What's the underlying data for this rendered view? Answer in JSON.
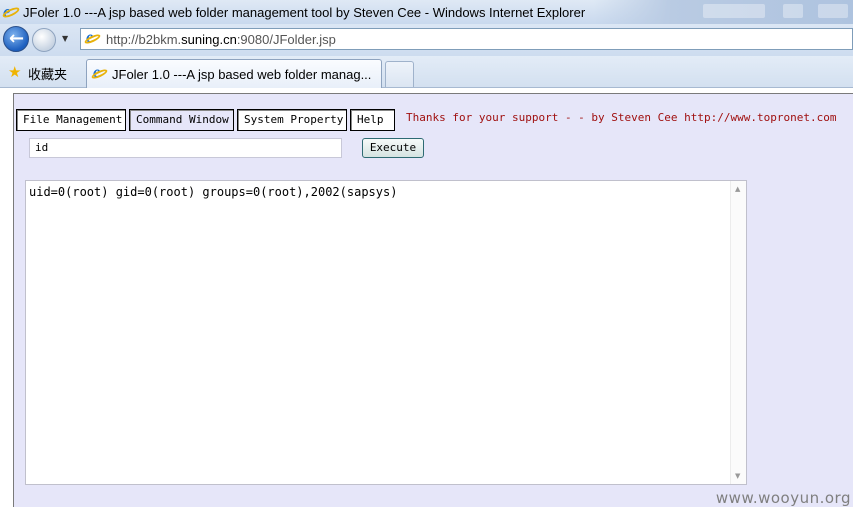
{
  "window": {
    "title": "JFoler 1.0 ---A jsp based web folder management tool by Steven Cee - Windows Internet Explorer"
  },
  "addressbar": {
    "url_prefix": "http://b2bkm.",
    "url_domain": "suning.cn",
    "url_suffix": ":9080/JFolder.jsp"
  },
  "favorites": {
    "label": "收藏夹"
  },
  "tab": {
    "title": "JFoler 1.0 ---A jsp based web folder manag..."
  },
  "menu": {
    "items": [
      {
        "label": "File Management"
      },
      {
        "label": "Command Window"
      },
      {
        "label": "System Property"
      },
      {
        "label": "Help"
      }
    ],
    "thanks": "Thanks for your support - - by Steven Cee http://www.topronet.com"
  },
  "command": {
    "value": "id",
    "execute_label": "Execute",
    "output": "uid=0(root) gid=0(root) groups=0(root),2002(sapsys)"
  },
  "watermark": "www.wooyun.org",
  "colors": {
    "thanks_text": "#a01010",
    "frame_bg": "#e6e6f9"
  }
}
